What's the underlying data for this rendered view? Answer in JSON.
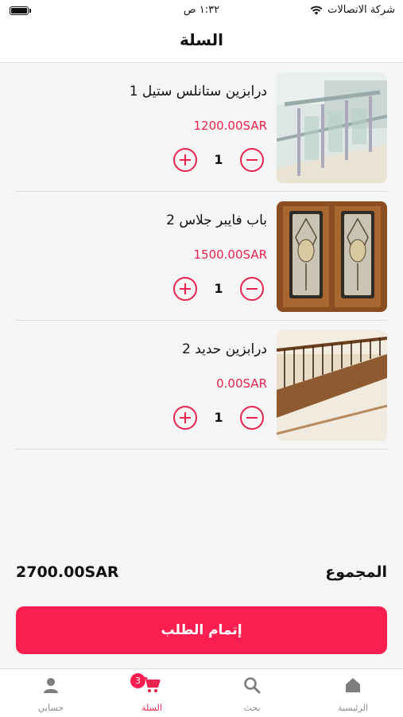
{
  "status_bar": {
    "carrier": "شركة الاتصالات",
    "time": "١:٣٢ ص"
  },
  "header": {
    "title": "السلة"
  },
  "cart": {
    "items": [
      {
        "name": "درابزين ستانلس ستيل 1",
        "price": "1200.00SAR",
        "quantity": "1",
        "image": "stainless-railing"
      },
      {
        "name": "باب فايبر جلاس 2",
        "price": "1500.00SAR",
        "quantity": "1",
        "image": "fiberglass-door"
      },
      {
        "name": "درابزين حديد 2",
        "price": "0.00SAR",
        "quantity": "1",
        "image": "iron-railing"
      }
    ]
  },
  "summary": {
    "total_label": "المجموع",
    "total_value": "2700.00SAR"
  },
  "checkout": {
    "label": "إتمام الطلب"
  },
  "tabbar": {
    "items": [
      {
        "label": "الرئيسية",
        "icon": "home-icon"
      },
      {
        "label": "بحث",
        "icon": "search-icon"
      },
      {
        "label": "السلة",
        "icon": "cart-icon",
        "badge": "3"
      },
      {
        "label": "حسابي",
        "icon": "user-icon"
      }
    ]
  },
  "colors": {
    "accent": "#fb1e51",
    "price": "#e8244e"
  }
}
